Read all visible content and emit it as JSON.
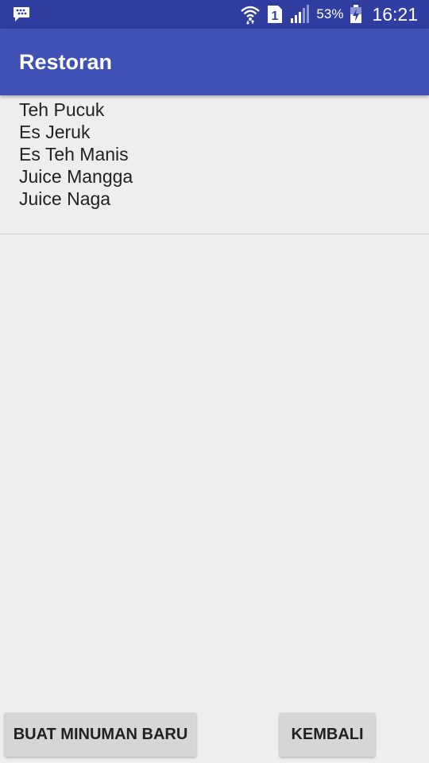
{
  "status_bar": {
    "notification_icon": "bbm-chat-icon",
    "wifi_icon": "wifi-icon",
    "sim_icon": "sim-1-icon",
    "sim_label": "1",
    "signal_icon": "signal-icon",
    "battery_percent": "53%",
    "battery_icon": "battery-charging-icon",
    "time": "16:21"
  },
  "app_bar": {
    "title": "Restoran",
    "color": "#3f51b5"
  },
  "menu": {
    "items": [
      {
        "label": "Teh Pucuk"
      },
      {
        "label": "Es Jeruk"
      },
      {
        "label": "Es Teh Manis"
      },
      {
        "label": "Juice Mangga"
      },
      {
        "label": "Juice Naga"
      }
    ]
  },
  "buttons": {
    "new_drink_label": "BUAT MINUMAN BARU",
    "back_label": "KEMBALI"
  },
  "colors": {
    "status_bar": "#2f3ea0",
    "primary": "#3f51b5",
    "background": "#eeeeee",
    "button": "#d6d6d6"
  }
}
